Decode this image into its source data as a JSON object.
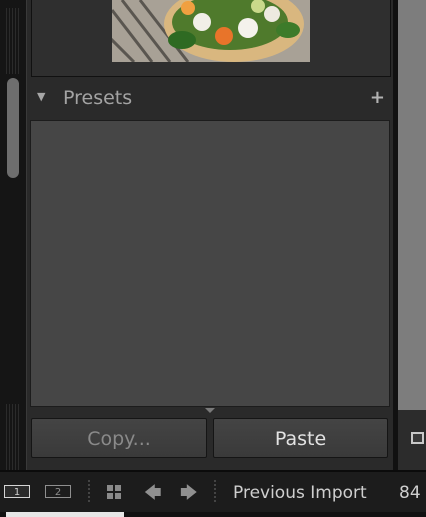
{
  "presets": {
    "title": "Presets",
    "disclosure_glyph": "▼",
    "add_glyph": "+"
  },
  "actions": {
    "copy_label": "Copy...",
    "paste_label": "Paste"
  },
  "filmstrip": {
    "monitor_1": "1",
    "monitor_2": "2",
    "prev_glyph": "🡄",
    "next_glyph": "🡆",
    "source_label": "Previous Import",
    "count": "84"
  },
  "colors": {
    "panel_bg": "#2a2a2a",
    "list_bg": "#464646",
    "text_dim": "#8a8a8a",
    "text_bright": "#e3e3e3"
  },
  "icons": [
    "grid-icon",
    "arrow-left-icon",
    "arrow-right-icon",
    "add-icon",
    "disclosure-triangle-icon"
  ]
}
